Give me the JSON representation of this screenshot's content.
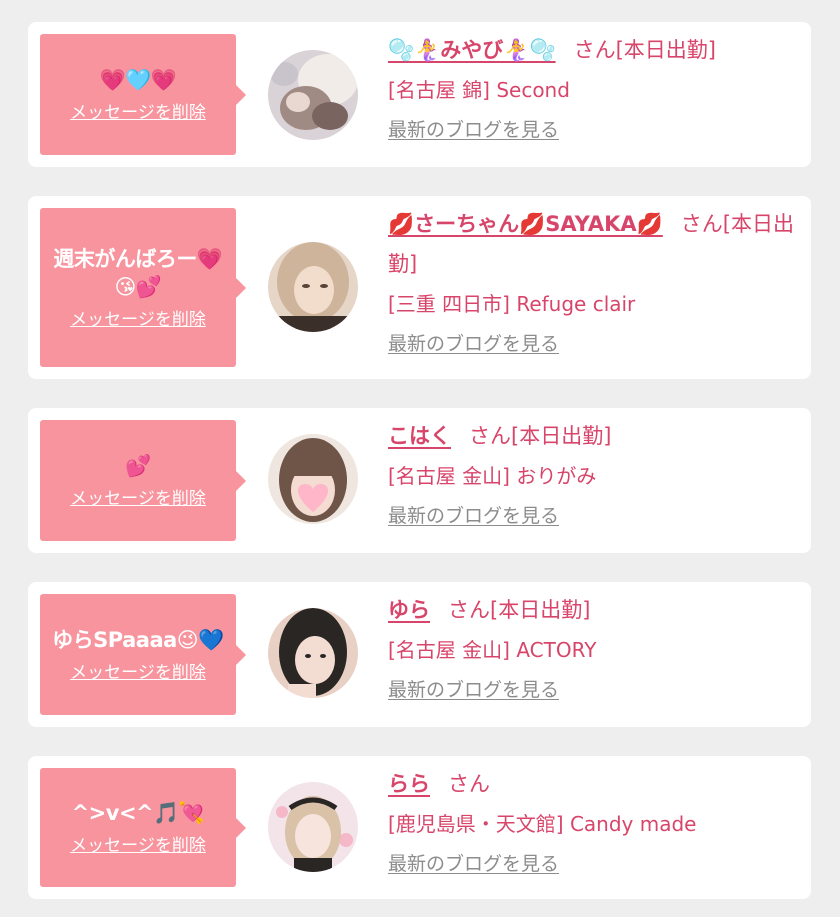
{
  "messages": [
    {
      "message": "💗🩵💗",
      "delete_label": "メッセージを削除",
      "avatar_icon": "photo-avatar",
      "avatar_colors": [
        "#d9d2d6",
        "#7a6460"
      ],
      "cast_name": "🫧🧜‍♀️みやび🧜‍♀️🫧",
      "honorific": "さん[本日出勤]",
      "shop": "[名古屋 錦] Second",
      "blog_label": "最新のブログを見る"
    },
    {
      "message": "週末がんばろー💗\n😘💕",
      "delete_label": "メッセージを削除",
      "avatar_icon": "photo-avatar",
      "avatar_colors": [
        "#e6d6c8",
        "#b89c7c"
      ],
      "cast_name": "💋さーちゃん💋SAYAKA💋",
      "honorific": "さん[本日出勤]",
      "shop": "[三重 四日市] Refuge clair",
      "blog_label": "最新のブログを見る"
    },
    {
      "message": "💕",
      "delete_label": "メッセージを削除",
      "avatar_icon": "photo-avatar",
      "avatar_colors": [
        "#efe6e0",
        "#6e5548"
      ],
      "cast_name": "こはく",
      "honorific": "さん[本日出勤]",
      "shop": "[名古屋 金山] おりがみ",
      "blog_label": "最新のブログを見る"
    },
    {
      "message": "ゆらSPaaaa😉💙",
      "delete_label": "メッセージを削除",
      "avatar_icon": "photo-avatar",
      "avatar_colors": [
        "#e8d0c4",
        "#2a2624"
      ],
      "cast_name": "ゆら",
      "honorific": "さん[本日出勤]",
      "shop": "[名古屋 金山] ACTORY",
      "blog_label": "最新のブログを見る"
    },
    {
      "message": "^>v<^🎵💘",
      "delete_label": "メッセージを削除",
      "avatar_icon": "photo-avatar",
      "avatar_colors": [
        "#f3e4ea",
        "#d9c2a8"
      ],
      "cast_name": "らら",
      "honorific": "さん",
      "shop": "[鹿児島県・天文館] Candy made",
      "blog_label": "最新のブログを見る"
    }
  ],
  "colors": {
    "accent": "#d8456a",
    "bubble": "#f8949e",
    "link_gray": "#8c8c8c",
    "background": "#eeeeee"
  }
}
